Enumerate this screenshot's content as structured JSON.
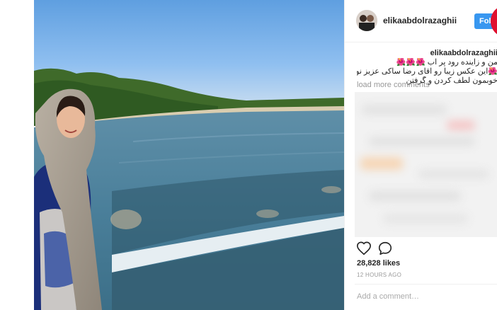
{
  "post": {
    "username": "elikaabdolrazaghii",
    "follow_label": "Foll",
    "caption": {
      "username": "elikaabdolrazaghii",
      "line1": "من و زاینده رود پر آب 🌺🌺🌺",
      "line2": "🌺این عکس زیبا رو آقای رضا ساکی عزیز نویسنده ی",
      "line3": "خوبمون لطف کردن و گرفتن"
    },
    "load_more": "load more comments",
    "likes": "28,828 likes",
    "timestamp": "12 HOURS AGO",
    "comment_placeholder": "Add a comment…"
  },
  "icons": {
    "like": "heart-icon",
    "comment": "comment-bubble-icon"
  },
  "colors": {
    "follow": "#3897f0",
    "badge": "#e0102f",
    "muted": "#999999",
    "text": "#262626"
  }
}
